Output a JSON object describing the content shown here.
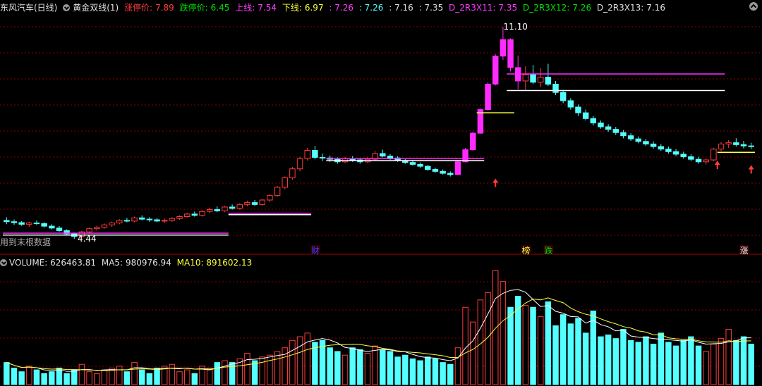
{
  "header": {
    "stock": "东风汽车(日线)",
    "indicator": "黄金双线(1)",
    "limit_up_label": "涨停价:",
    "limit_up": "7.89",
    "limit_down_label": "跌停价:",
    "limit_down": "6.45",
    "upper_label": "上线:",
    "upper": "7.54",
    "lower_label": "下线:",
    "lower": "6.97",
    "v1": ": 7.26",
    "v2": ": 7.26",
    "v3": ": 7.16",
    "v4": ": 7.35",
    "d11_label": "D_2R3X11:",
    "d11": "7.35",
    "d12_label": "D_2R3X12:",
    "d12": "7.26",
    "d13_label": "D_2R3X13:",
    "d13": "7.16"
  },
  "volume_header": {
    "vol_label": "VOLUME:",
    "vol": "626463.81",
    "ma5_label": "MA5:",
    "ma5": "980976.94",
    "ma10_label": "MA10:",
    "ma10": "891602.13"
  },
  "annotations": {
    "high_price": "11.10",
    "low_price": "4.44",
    "bottom_note": "用到末根数据",
    "tags": [
      "财",
      "榜",
      "跌",
      "涨"
    ]
  },
  "colors": {
    "up": "#ff3c3c",
    "down": "#54ffff",
    "magenta": "#ff2bff",
    "green": "#00e000",
    "yellow": "#ffff40",
    "white": "#ffffff",
    "grid": "#8b0000",
    "label_pink": "#ff3cff"
  },
  "chart_data": {
    "type": "candlestick",
    "series": [
      {
        "name": "price",
        "x_count": 100,
        "ohlc": [
          [
            5.02,
            5.12,
            4.9,
            4.98
          ],
          [
            4.98,
            5.05,
            4.88,
            4.95
          ],
          [
            4.95,
            5.0,
            4.85,
            4.9
          ],
          [
            4.9,
            4.98,
            4.82,
            4.94
          ],
          [
            4.94,
            5.02,
            4.88,
            4.92
          ],
          [
            4.92,
            4.96,
            4.8,
            4.84
          ],
          [
            4.84,
            4.9,
            4.74,
            4.78
          ],
          [
            4.78,
            4.84,
            4.66,
            4.7
          ],
          [
            4.7,
            4.74,
            4.56,
            4.6
          ],
          [
            4.6,
            4.64,
            4.44,
            4.52
          ],
          [
            4.52,
            4.7,
            4.48,
            4.66
          ],
          [
            4.66,
            4.8,
            4.6,
            4.76
          ],
          [
            4.76,
            4.86,
            4.7,
            4.8
          ],
          [
            4.8,
            4.92,
            4.76,
            4.88
          ],
          [
            4.88,
            4.98,
            4.82,
            4.94
          ],
          [
            4.94,
            5.06,
            4.9,
            5.02
          ],
          [
            5.02,
            5.1,
            4.96,
            5.0
          ],
          [
            5.0,
            5.14,
            4.96,
            5.1
          ],
          [
            5.1,
            5.18,
            5.02,
            5.06
          ],
          [
            5.06,
            5.12,
            4.98,
            5.04
          ],
          [
            5.04,
            5.1,
            4.96,
            5.0
          ],
          [
            5.0,
            5.08,
            4.94,
            5.02
          ],
          [
            5.02,
            5.12,
            4.98,
            5.08
          ],
          [
            5.08,
            5.18,
            5.04,
            5.14
          ],
          [
            5.14,
            5.26,
            5.1,
            5.22
          ],
          [
            5.22,
            5.3,
            5.14,
            5.18
          ],
          [
            5.18,
            5.34,
            5.14,
            5.3
          ],
          [
            5.3,
            5.42,
            5.24,
            5.36
          ],
          [
            5.36,
            5.46,
            5.28,
            5.32
          ],
          [
            5.32,
            5.48,
            5.28,
            5.44
          ],
          [
            5.44,
            5.52,
            5.36,
            5.4
          ],
          [
            5.4,
            5.56,
            5.36,
            5.52
          ],
          [
            5.52,
            5.64,
            5.46,
            5.58
          ],
          [
            5.58,
            5.66,
            5.48,
            5.52
          ],
          [
            5.52,
            5.7,
            5.48,
            5.66
          ],
          [
            5.66,
            5.84,
            5.6,
            5.8
          ],
          [
            5.8,
            6.1,
            5.76,
            6.06
          ],
          [
            6.06,
            6.4,
            6.0,
            6.36
          ],
          [
            6.36,
            6.7,
            6.3,
            6.64
          ],
          [
            6.64,
            7.02,
            6.56,
            6.96
          ],
          [
            6.96,
            7.3,
            6.9,
            7.22
          ],
          [
            7.22,
            7.36,
            6.94,
            7.0
          ],
          [
            7.0,
            7.12,
            6.88,
            6.98
          ],
          [
            6.98,
            7.06,
            6.86,
            6.94
          ],
          [
            6.94,
            7.0,
            6.8,
            6.86
          ],
          [
            6.86,
            7.02,
            6.82,
            6.96
          ],
          [
            6.96,
            7.04,
            6.86,
            6.92
          ],
          [
            6.92,
            6.98,
            6.8,
            6.86
          ],
          [
            6.86,
            7.0,
            6.82,
            6.94
          ],
          [
            6.94,
            7.2,
            6.9,
            7.12
          ],
          [
            7.12,
            7.24,
            7.0,
            7.04
          ],
          [
            7.04,
            7.1,
            6.92,
            6.98
          ],
          [
            6.98,
            7.04,
            6.86,
            6.9
          ],
          [
            6.9,
            6.96,
            6.8,
            6.84
          ],
          [
            6.84,
            6.92,
            6.74,
            6.78
          ],
          [
            6.78,
            6.84,
            6.66,
            6.72
          ],
          [
            6.72,
            6.76,
            6.58,
            6.62
          ],
          [
            6.62,
            6.68,
            6.52,
            6.56
          ],
          [
            6.56,
            6.62,
            6.46,
            6.5
          ],
          [
            6.5,
            6.56,
            6.4,
            6.46
          ],
          [
            6.46,
            6.9,
            6.44,
            6.86
          ],
          [
            6.86,
            7.3,
            6.84,
            7.24
          ],
          [
            7.24,
            7.8,
            7.2,
            7.76
          ],
          [
            7.76,
            8.54,
            7.74,
            8.5
          ],
          [
            8.5,
            9.36,
            8.48,
            9.3
          ],
          [
            9.3,
            10.24,
            9.26,
            10.18
          ],
          [
            10.18,
            11.1,
            10.06,
            10.7
          ],
          [
            10.7,
            10.74,
            9.7,
            9.82
          ],
          [
            9.82,
            10.2,
            9.14,
            9.4
          ],
          [
            9.4,
            9.86,
            9.1,
            9.6
          ],
          [
            9.6,
            9.9,
            9.3,
            9.36
          ],
          [
            9.36,
            9.8,
            9.2,
            9.52
          ],
          [
            9.52,
            9.94,
            9.24,
            9.3
          ],
          [
            9.3,
            9.4,
            8.96,
            9.04
          ],
          [
            9.04,
            9.12,
            8.7,
            8.78
          ],
          [
            8.78,
            8.86,
            8.5,
            8.58
          ],
          [
            8.58,
            8.66,
            8.3,
            8.4
          ],
          [
            8.4,
            8.5,
            8.16,
            8.22
          ],
          [
            8.22,
            8.3,
            8.0,
            8.08
          ],
          [
            8.08,
            8.16,
            7.9,
            7.96
          ],
          [
            7.96,
            8.04,
            7.8,
            7.88
          ],
          [
            7.88,
            7.96,
            7.7,
            7.78
          ],
          [
            7.78,
            7.86,
            7.6,
            7.68
          ],
          [
            7.68,
            7.76,
            7.52,
            7.58
          ],
          [
            7.58,
            7.66,
            7.44,
            7.5
          ],
          [
            7.5,
            7.58,
            7.36,
            7.42
          ],
          [
            7.42,
            7.5,
            7.28,
            7.34
          ],
          [
            7.34,
            7.42,
            7.2,
            7.26
          ],
          [
            7.26,
            7.34,
            7.12,
            7.18
          ],
          [
            7.18,
            7.26,
            7.04,
            7.1
          ],
          [
            7.1,
            7.18,
            6.96,
            7.02
          ],
          [
            7.02,
            7.1,
            6.88,
            6.94
          ],
          [
            6.94,
            7.02,
            6.8,
            6.86
          ],
          [
            6.86,
            6.96,
            6.78,
            6.92
          ],
          [
            6.92,
            7.3,
            6.88,
            7.26
          ],
          [
            7.26,
            7.48,
            7.2,
            7.42
          ],
          [
            7.42,
            7.54,
            7.3,
            7.46
          ],
          [
            7.46,
            7.6,
            7.34,
            7.4
          ],
          [
            7.4,
            7.52,
            7.28,
            7.36
          ],
          [
            7.36,
            7.46,
            7.26,
            7.35
          ]
        ]
      }
    ],
    "volume": [
      120,
      90,
      70,
      100,
      80,
      60,
      70,
      90,
      60,
      80,
      110,
      70,
      60,
      80,
      90,
      100,
      70,
      120,
      80,
      60,
      90,
      100,
      110,
      70,
      80,
      60,
      100,
      90,
      120,
      130,
      120,
      140,
      170,
      130,
      150,
      160,
      180,
      200,
      240,
      260,
      280,
      230,
      240,
      200,
      180,
      160,
      200,
      190,
      170,
      210,
      190,
      180,
      150,
      160,
      140,
      130,
      150,
      140,
      120,
      110,
      200,
      420,
      340,
      460,
      500,
      620,
      560,
      420,
      480,
      430,
      420,
      370,
      450,
      320,
      380,
      330,
      360,
      280,
      400,
      260,
      270,
      250,
      300,
      240,
      230,
      260,
      220,
      280,
      230,
      210,
      240,
      260,
      210,
      180,
      220,
      250,
      300,
      240,
      260,
      220
    ],
    "ma5": [],
    "ma10": [],
    "ylim": [
      4.2,
      11.5
    ]
  }
}
